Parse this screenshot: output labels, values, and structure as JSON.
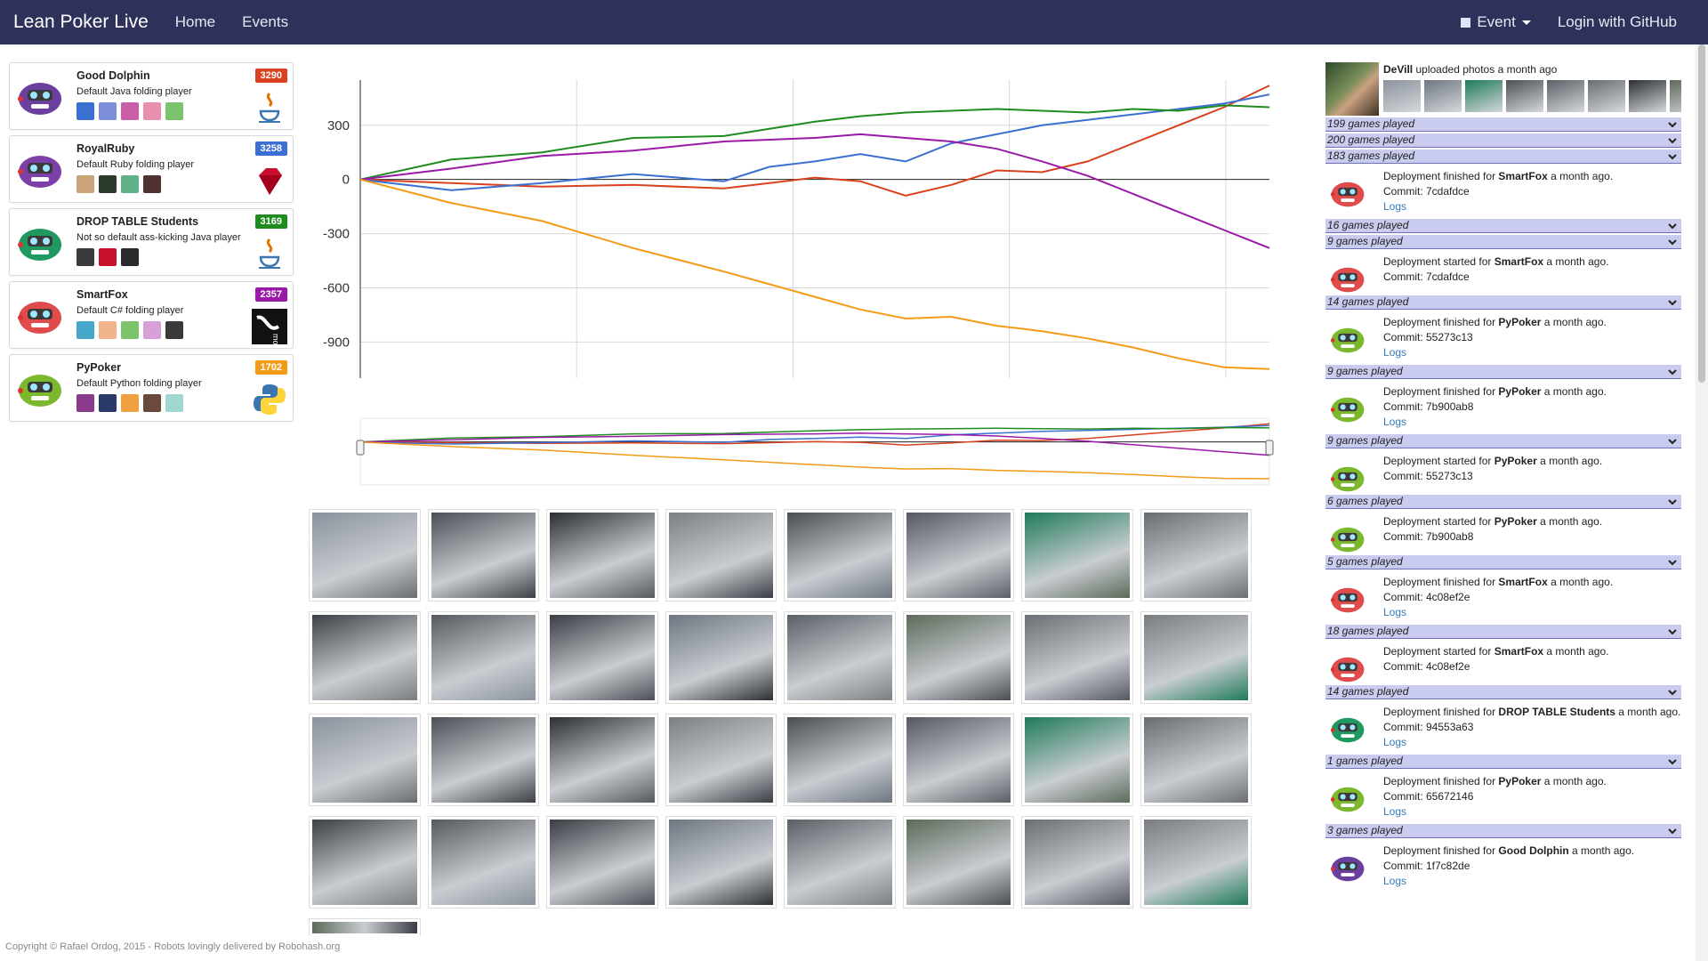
{
  "navbar": {
    "brand": "Lean Poker Live",
    "links": [
      "Home",
      "Events"
    ],
    "event_label": "Event",
    "login_label": "Login with GitHub"
  },
  "players": [
    {
      "name": "Good Dolphin",
      "description": "Default Java folding player",
      "score": "3290",
      "score_color": "#d9421f",
      "color": "#6b3fa0",
      "lang_icon": "java-icon"
    },
    {
      "name": "RoyalRuby",
      "description": "Default Ruby folding player",
      "score": "3258",
      "score_color": "#3b6fd1",
      "color": "#7d3fa8",
      "lang_icon": "ruby-icon"
    },
    {
      "name": "DROP TABLE Students",
      "description": "Not so default ass-kicking Java player",
      "score": "3169",
      "score_color": "#1e8c1e",
      "color": "#1f9960",
      "lang_icon": "java-icon"
    },
    {
      "name": "SmartFox",
      "description": "Default C# folding player",
      "score": "2357",
      "score_color": "#9a1aa8",
      "color": "#e04b4b",
      "lang_icon": "mono-icon"
    },
    {
      "name": "PyPoker",
      "description": "Default Python folding player",
      "score": "1702",
      "score_color": "#f39a17",
      "color": "#7cb82e",
      "lang_icon": "python-icon"
    }
  ],
  "chart_data": {
    "type": "line",
    "ytick_labels": [
      "300",
      "0",
      "-300",
      "-600",
      "-900"
    ],
    "yticks": [
      300,
      0,
      -300,
      -600,
      -900
    ],
    "ylim": [
      -1100,
      550
    ],
    "x_range": [
      0,
      100
    ],
    "grid": true,
    "series": [
      {
        "color": "#d9421f",
        "x": [
          0,
          10,
          20,
          30,
          40,
          45,
          50,
          55,
          60,
          65,
          70,
          75,
          80,
          85,
          90,
          95,
          100
        ],
        "y": [
          0,
          -20,
          -40,
          -30,
          -50,
          -20,
          10,
          -10,
          -90,
          -30,
          50,
          40,
          100,
          200,
          300,
          400,
          520
        ]
      },
      {
        "color": "#3b6fd1",
        "x": [
          0,
          10,
          20,
          30,
          40,
          45,
          50,
          55,
          60,
          65,
          70,
          75,
          80,
          85,
          90,
          95,
          100
        ],
        "y": [
          0,
          -60,
          -20,
          30,
          -10,
          70,
          100,
          140,
          100,
          200,
          250,
          300,
          330,
          360,
          390,
          420,
          470
        ]
      },
      {
        "color": "#1e8c1e",
        "x": [
          0,
          10,
          20,
          30,
          40,
          45,
          50,
          55,
          60,
          65,
          70,
          75,
          80,
          85,
          90,
          95,
          100
        ],
        "y": [
          0,
          110,
          150,
          230,
          240,
          280,
          320,
          350,
          370,
          380,
          390,
          380,
          370,
          390,
          380,
          410,
          400
        ]
      },
      {
        "color": "#9a1aa8",
        "x": [
          0,
          10,
          20,
          30,
          40,
          45,
          50,
          55,
          60,
          65,
          70,
          75,
          80,
          85,
          90,
          95,
          100
        ],
        "y": [
          0,
          60,
          130,
          160,
          210,
          220,
          230,
          250,
          230,
          210,
          170,
          100,
          20,
          -80,
          -180,
          -280,
          -380
        ]
      },
      {
        "color": "#f39a17",
        "x": [
          0,
          10,
          20,
          30,
          40,
          45,
          50,
          55,
          60,
          65,
          70,
          75,
          80,
          85,
          90,
          95,
          100
        ],
        "y": [
          0,
          -130,
          -230,
          -380,
          -510,
          -580,
          -650,
          -720,
          -770,
          -760,
          -810,
          -840,
          -880,
          -930,
          -990,
          -1040,
          -1050
        ]
      }
    ]
  },
  "gallery": {
    "rows": 4,
    "columns": 8,
    "colors": [
      "#8b929c",
      "#6e7680",
      "#1f7a5a",
      "#4c4f55",
      "#5a6066",
      "#6a6d70",
      "#2c2f33",
      "#5d6a5a",
      "#3d4045",
      "#7c7f82",
      "#6b6e72",
      "#56595d",
      "#4a4d52",
      "#7a7d80",
      "#3a3e44",
      "#545860"
    ]
  },
  "feed": {
    "upload": {
      "user": "DeVill",
      "text": "uploaded photos a month ago"
    },
    "items": [
      {
        "kind": "games",
        "text": "199 games played"
      },
      {
        "kind": "games",
        "text": "200 games played"
      },
      {
        "kind": "games",
        "text": "183 games played"
      },
      {
        "kind": "deploy",
        "text_pre": "Deployment finished for ",
        "player": "SmartFox",
        "text_post": " a month ago.",
        "commit": "Commit: 7cdafdce",
        "logs": "Logs",
        "color": "#e04b4b"
      },
      {
        "kind": "games",
        "text": "16 games played"
      },
      {
        "kind": "games",
        "text": "9 games played"
      },
      {
        "kind": "deploy",
        "text_pre": "Deployment started for ",
        "player": "SmartFox",
        "text_post": " a month ago.",
        "commit": "Commit: 7cdafdce",
        "logs": "",
        "color": "#e04b4b"
      },
      {
        "kind": "games",
        "text": "14 games played"
      },
      {
        "kind": "deploy",
        "text_pre": "Deployment finished for ",
        "player": "PyPoker",
        "text_post": " a month ago.",
        "commit": "Commit: 55273c13",
        "logs": "Logs",
        "color": "#7cb82e"
      },
      {
        "kind": "games",
        "text": "9 games played"
      },
      {
        "kind": "deploy",
        "text_pre": "Deployment finished for ",
        "player": "PyPoker",
        "text_post": " a month ago.",
        "commit": "Commit: 7b900ab8",
        "logs": "Logs",
        "color": "#7cb82e"
      },
      {
        "kind": "games",
        "text": "9 games played"
      },
      {
        "kind": "deploy",
        "text_pre": "Deployment started for ",
        "player": "PyPoker",
        "text_post": " a month ago.",
        "commit": "Commit: 55273c13",
        "logs": "",
        "color": "#7cb82e"
      },
      {
        "kind": "games",
        "text": "6 games played"
      },
      {
        "kind": "deploy",
        "text_pre": "Deployment started for ",
        "player": "PyPoker",
        "text_post": " a month ago.",
        "commit": "Commit: 7b900ab8",
        "logs": "",
        "color": "#7cb82e"
      },
      {
        "kind": "games",
        "text": "5 games played"
      },
      {
        "kind": "deploy",
        "text_pre": "Deployment finished for ",
        "player": "SmartFox",
        "text_post": " a month ago.",
        "commit": "Commit: 4c08ef2e",
        "logs": "Logs",
        "color": "#e04b4b"
      },
      {
        "kind": "games",
        "text": "18 games played"
      },
      {
        "kind": "deploy",
        "text_pre": "Deployment started for ",
        "player": "SmartFox",
        "text_post": " a month ago.",
        "commit": "Commit: 4c08ef2e",
        "logs": "",
        "color": "#e04b4b"
      },
      {
        "kind": "games",
        "text": "14 games played"
      },
      {
        "kind": "deploy",
        "text_pre": "Deployment finished for ",
        "player": "DROP TABLE Students",
        "text_post": " a month ago.",
        "commit": "Commit: 94553a63",
        "logs": "Logs",
        "color": "#1f9960"
      },
      {
        "kind": "games",
        "text": "1 games played"
      },
      {
        "kind": "deploy",
        "text_pre": "Deployment finished for ",
        "player": "PyPoker",
        "text_post": " a month ago.",
        "commit": "Commit: 65672146",
        "logs": "Logs",
        "color": "#7cb82e"
      },
      {
        "kind": "games",
        "text": "3 games played"
      },
      {
        "kind": "deploy",
        "text_pre": "Deployment finished for ",
        "player": "Good Dolphin",
        "text_post": " a month ago.",
        "commit": "Commit: 1f7c82de",
        "logs": "Logs",
        "color": "#6b3fa0"
      }
    ]
  },
  "footer": "Copyright © Rafael Ordog, 2015 - Robots lovingly delivered by Robohash.org"
}
